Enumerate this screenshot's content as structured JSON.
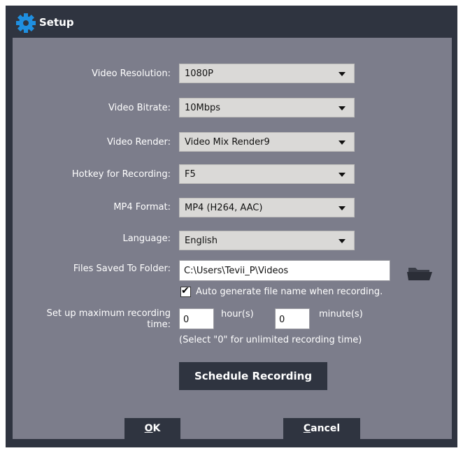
{
  "window": {
    "title": "Setup"
  },
  "fields": {
    "video_resolution": {
      "label": "Video Resolution:",
      "value": "1080P"
    },
    "video_bitrate": {
      "label": "Video Bitrate:",
      "value": "10Mbps"
    },
    "video_render": {
      "label": "Video Render:",
      "value": "Video Mix Render9"
    },
    "hotkey": {
      "label": "Hotkey for Recording:",
      "value": "F5"
    },
    "mp4_format": {
      "label": "MP4 Format:",
      "value": "MP4 (H264, AAC)"
    },
    "language": {
      "label": "Language:",
      "value": "English"
    },
    "folder": {
      "label": "Files Saved To Folder:",
      "value": "C:\\Users\\Tevii_P\\Videos"
    }
  },
  "auto_name": {
    "label": "Auto generate file name when recording.",
    "checked": true
  },
  "max_time": {
    "label": "Set up maximum recording time:",
    "hours": "0",
    "hours_unit": "hour(s)",
    "minutes": "0",
    "minutes_unit": "minute(s)",
    "hint": "(Select \"0\" for unlimited recording time)"
  },
  "buttons": {
    "schedule": "Schedule Recording",
    "ok_first": "O",
    "ok_rest": "K",
    "cancel_first": "C",
    "cancel_rest": "ancel"
  },
  "icons": {
    "title": "gear-icon",
    "folder": "folder-icon",
    "dropdown": "chevron-down-icon",
    "checkbox": "checkmark-icon"
  },
  "colors": {
    "frame": "#2f3440",
    "panel": "#7c7d8b",
    "select_bg": "#dad9d7",
    "gear": "#1f8fe0"
  }
}
